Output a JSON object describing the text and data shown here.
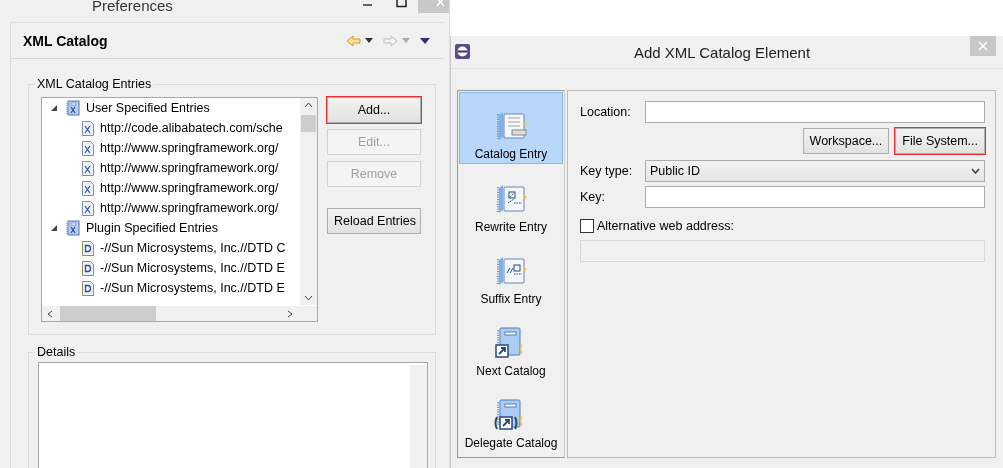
{
  "preferences": {
    "title": "Preferences",
    "page_title": "XML Catalog",
    "entries_group": {
      "label": "XML Catalog Entries",
      "tree": [
        {
          "label": "User Specified Entries",
          "kind": "group",
          "expanded": true,
          "children": [
            {
              "label": "http://code.alibabatech.com/sche",
              "kind": "xml"
            },
            {
              "label": "http://www.springframework.org/",
              "kind": "xml"
            },
            {
              "label": "http://www.springframework.org/",
              "kind": "xml"
            },
            {
              "label": "http://www.springframework.org/",
              "kind": "xml"
            },
            {
              "label": "http://www.springframework.org/",
              "kind": "xml"
            }
          ]
        },
        {
          "label": "Plugin Specified Entries",
          "kind": "group",
          "expanded": true,
          "children": [
            {
              "label": "-//Sun Microsystems, Inc.//DTD C",
              "kind": "dtd"
            },
            {
              "label": "-//Sun Microsystems, Inc.//DTD E",
              "kind": "dtd"
            },
            {
              "label": "-//Sun Microsystems, Inc.//DTD E",
              "kind": "dtd"
            }
          ]
        }
      ],
      "buttons": [
        {
          "label": "Add...",
          "disabled": false,
          "highlighted": true
        },
        {
          "label": "Edit...",
          "disabled": true,
          "highlighted": false
        },
        {
          "label": "Remove",
          "disabled": true,
          "highlighted": false
        },
        {
          "label": "Reload Entries",
          "disabled": false,
          "highlighted": false
        }
      ]
    },
    "details": {
      "label": "Details"
    }
  },
  "dialog": {
    "title": "Add XML Catalog Element",
    "categories": [
      {
        "label": "Catalog Entry",
        "kind": "catalog",
        "selected": true
      },
      {
        "label": "Rewrite Entry",
        "kind": "rewrite",
        "selected": false
      },
      {
        "label": "Suffix Entry",
        "kind": "suffix",
        "selected": false
      },
      {
        "label": "Next Catalog",
        "kind": "next",
        "selected": false
      },
      {
        "label": "Delegate Catalog",
        "kind": "delegate",
        "selected": false
      }
    ],
    "location": {
      "label": "Location:"
    },
    "buttons": [
      {
        "label": "Workspace...",
        "highlighted": false
      },
      {
        "label": "File System...",
        "highlighted": true
      }
    ],
    "key_type": {
      "label": "Key type:",
      "value": "Public ID"
    },
    "key": {
      "label": "Key:"
    },
    "alternative": {
      "label": "Alternative web address:",
      "checked": false,
      "disabled": true
    }
  }
}
